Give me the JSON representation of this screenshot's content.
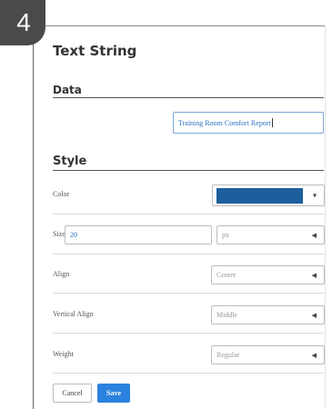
{
  "step_number": "4",
  "title": "Text String",
  "sections": {
    "data": "Data",
    "style": "Style"
  },
  "data_field": {
    "value": "Training Room Comfort Report"
  },
  "style": {
    "color_label": "Color",
    "color_value": "#1d5f9d",
    "size_label": "Size",
    "size_value": "20",
    "size_unit": "px",
    "align_label": "Align",
    "align_value": "Center",
    "valign_label": "Vertical Align",
    "valign_value": "Middle",
    "weight_label": "Weight",
    "weight_value": "Regular"
  },
  "buttons": {
    "cancel": "Cancel",
    "save": "Save"
  },
  "colors": {
    "accent": "#2b82de",
    "swatch": "#1d5f9d",
    "badge": "#4a4a4a"
  }
}
